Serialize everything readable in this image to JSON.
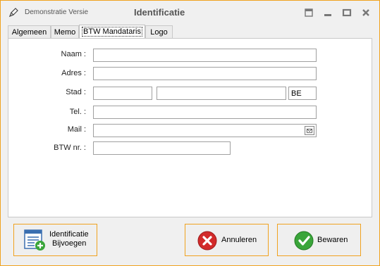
{
  "titlebar": {
    "app_name": "Demonstratie Versie",
    "title": "Identificatie",
    "icons": [
      "pencil-icon",
      "restore-icon",
      "minimize-icon",
      "maximize-icon",
      "close-icon"
    ]
  },
  "tabs": [
    {
      "label": "Algemeen",
      "active": false
    },
    {
      "label": "Memo",
      "active": false
    },
    {
      "label": "BTW Mandataris",
      "active": true
    },
    {
      "label": "Logo",
      "active": false
    }
  ],
  "form": {
    "naam_label": "Naam :",
    "naam_value": "",
    "adres_label": "Adres :",
    "adres_value": "",
    "stad_label": "Stad :",
    "postcode_value": "",
    "stad_value": "",
    "land_value": "BE",
    "tel_label": "Tel. :",
    "tel_value": "",
    "mail_label": "Mail :",
    "mail_value": "",
    "btw_label": "BTW nr. :",
    "btw_value": ""
  },
  "buttons": {
    "add_line1": "Identificatie",
    "add_line2": "Bijvoegen",
    "cancel_label": "Annuleren",
    "save_label": "Bewaren"
  },
  "colors": {
    "accent_border": "#f0a21f",
    "cancel_red": "#d22a2a",
    "save_green": "#3aa53a"
  }
}
